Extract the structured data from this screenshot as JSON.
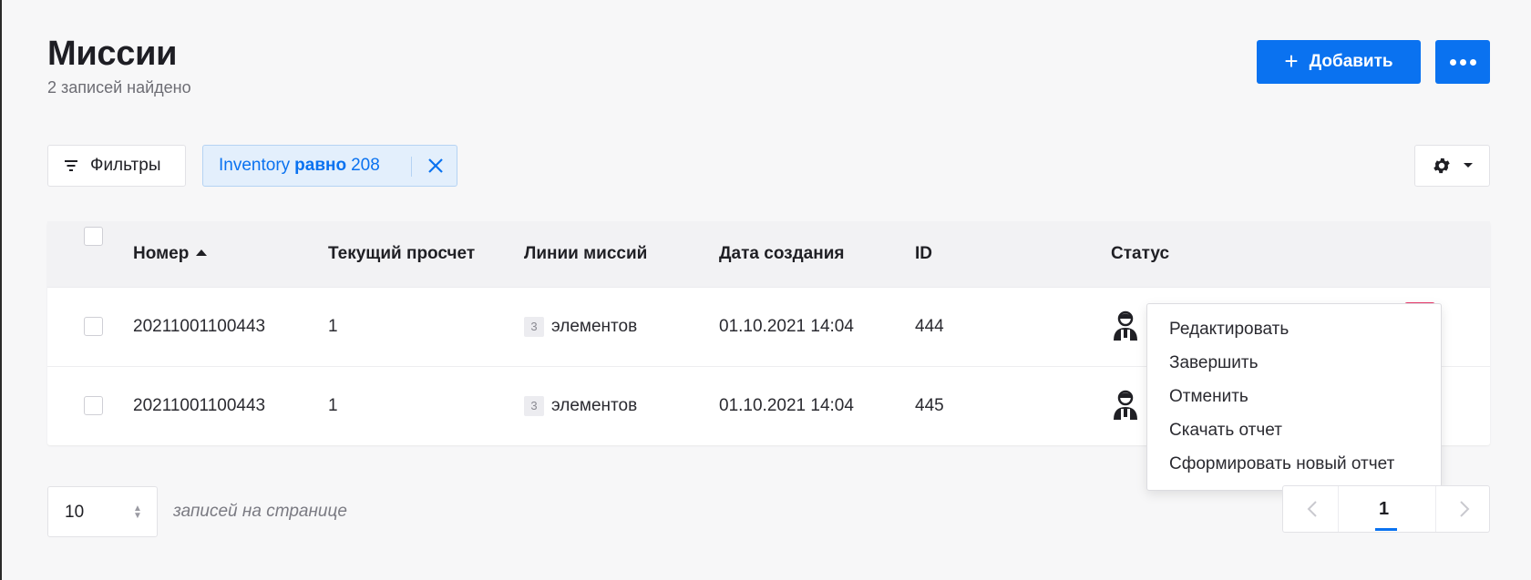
{
  "page": {
    "title": "Миссии",
    "subtitle": "2 записей найдено"
  },
  "toolbar": {
    "add_label": "Добавить",
    "filters_label": "Фильтры",
    "filter_chip": {
      "field": "Inventory",
      "operator": "равно",
      "value": "208"
    }
  },
  "table": {
    "columns": [
      "Номер",
      "Текущий просчет",
      "Линии миссий",
      "Дата создания",
      "ID",
      "Статус"
    ],
    "rows": [
      {
        "number": "20211001100443",
        "recount": "1",
        "lines_count": "3",
        "lines_label": "элементов",
        "created": "01.10.2021 14:04",
        "id": "444"
      },
      {
        "number": "20211001100443",
        "recount": "1",
        "lines_count": "3",
        "lines_label": "элементов",
        "created": "01.10.2021 14:04",
        "id": "445"
      }
    ]
  },
  "row_menu": {
    "items": [
      "Редактировать",
      "Завершить",
      "Отменить",
      "Скачать отчет",
      "Сформировать новый отчет"
    ]
  },
  "pagination": {
    "page_size": "10",
    "page_size_label": "записей на странице",
    "current_page": "1"
  },
  "colors": {
    "accent": "#0a72f0",
    "highlight": "#e9386a",
    "chip_bg": "#e3effc"
  },
  "icons": [
    "plus-icon",
    "more-icon",
    "filter-icon",
    "close-icon",
    "gear-icon",
    "caret-down-icon",
    "sort-asc-icon",
    "user-status-icon",
    "kebab-icon",
    "chevron-left-icon",
    "chevron-right-icon"
  ]
}
